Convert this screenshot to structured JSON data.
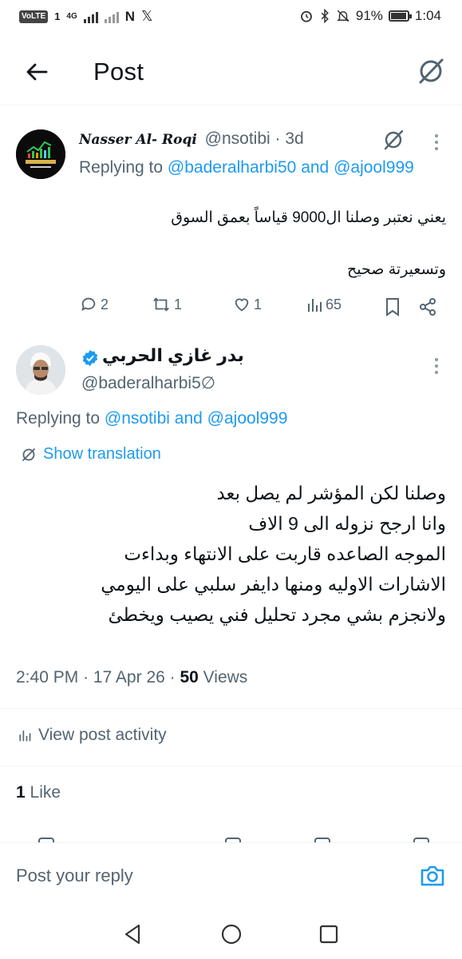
{
  "status_bar": {
    "volte": "VoLTE",
    "sim": "1",
    "network": "4G",
    "battery": "91%",
    "time": "1:04"
  },
  "header": {
    "title": "Post"
  },
  "parent_tweet": {
    "name": "Nasser Al- Roqi",
    "handle": "@nsotibi",
    "age": "· 3d",
    "replying_prefix": "Replying to",
    "replying_user1": "@baderalharbi50",
    "replying_and": "and",
    "replying_user2": "@ajool999",
    "text_line1": "يعني نعتبر وصلنا ال9000 قياساً بعمق السوق",
    "text_line2": "وتسعيرتة صحيح",
    "replies": "2",
    "reposts": "1",
    "likes": "1",
    "views": "65"
  },
  "focal_tweet": {
    "name": "بدر غازي الحربي",
    "handle": "@baderalharbi5∅",
    "replying_prefix": "Replying to",
    "replying_user1": "@nsotibi",
    "replying_and": "and",
    "replying_user2": "@ajool999",
    "translate_label": "Show translation",
    "lines": [
      "وصلنا لكن المؤشر لم يصل بعد",
      "وانا ارجح نزوله الى 9 الاف",
      "الموجه الصاعده قاربت على الانتهاء وبداءت",
      "الاشارات الاوليه ومنها دايفر سلبي على اليومي",
      "ولانجزم بشي مجرد تحليل فني يصيب ويخطئ"
    ],
    "time": "2:40 PM",
    "date": "17 Apr 26",
    "views_count": "50",
    "views_label": "Views",
    "activity_label": "View post activity",
    "likes_count": "1",
    "likes_label": "Like"
  },
  "reply_bar": {
    "placeholder": "Post your reply"
  },
  "colors": {
    "accent": "#1d9bf0",
    "muted": "#536471",
    "text": "#0f1419"
  }
}
